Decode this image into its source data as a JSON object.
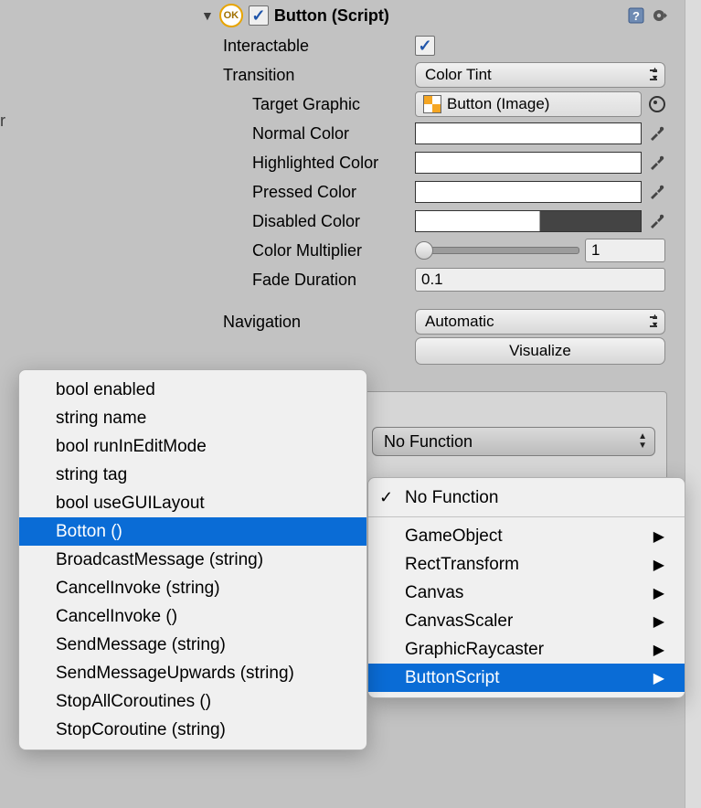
{
  "component": {
    "ok_badge": "OK",
    "title": "Button (Script)",
    "enabled": true
  },
  "fields": {
    "interactable_label": "Interactable",
    "interactable_value": true,
    "transition_label": "Transition",
    "transition_value": "Color Tint",
    "target_graphic_label": "Target Graphic",
    "target_graphic_value": "Button (Image)",
    "normal_color_label": "Normal Color",
    "highlighted_color_label": "Highlighted Color",
    "pressed_color_label": "Pressed Color",
    "disabled_color_label": "Disabled Color",
    "colors": {
      "normal": "#ffffff",
      "highlighted": "#ffffff",
      "pressed": "#ffffff",
      "disabled_left": "#ffffff",
      "disabled_right": "#3f3f3f"
    },
    "color_multiplier_label": "Color Multiplier",
    "color_multiplier_value": "1",
    "fade_duration_label": "Fade Duration",
    "fade_duration_value": "0.1",
    "navigation_label": "Navigation",
    "navigation_value": "Automatic",
    "visualize_label": "Visualize"
  },
  "events": {
    "no_function_label": "No Function"
  },
  "menu_left": {
    "items": [
      "bool enabled",
      "string name",
      "bool runInEditMode",
      "string tag",
      "bool useGUILayout",
      "Botton ()",
      "BroadcastMessage (string)",
      "CancelInvoke (string)",
      "CancelInvoke ()",
      "SendMessage (string)",
      "SendMessageUpwards (string)",
      "StopAllCoroutines ()",
      "StopCoroutine (string)"
    ],
    "highlight_index": 5
  },
  "menu_right": {
    "checked_index": 0,
    "items": [
      {
        "label": "No Function",
        "submenu": false
      },
      {
        "divider": true
      },
      {
        "label": "GameObject",
        "submenu": true
      },
      {
        "label": "RectTransform",
        "submenu": true
      },
      {
        "label": "Canvas",
        "submenu": true
      },
      {
        "label": "CanvasScaler",
        "submenu": true
      },
      {
        "label": "GraphicRaycaster",
        "submenu": true
      },
      {
        "label": "ButtonScript",
        "submenu": true
      }
    ],
    "highlight_index": 7
  },
  "hierarchy_fragments": {
    "frag1": "er",
    "frag2": "‹"
  }
}
